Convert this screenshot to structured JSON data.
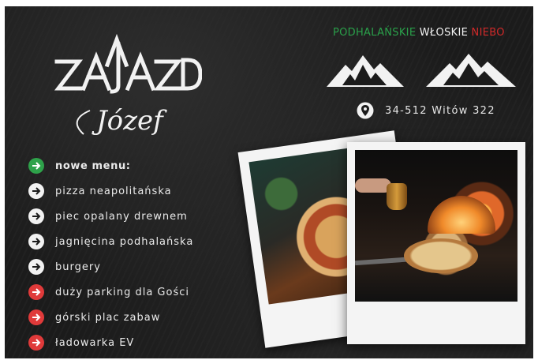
{
  "logo": {
    "word": "ZAJAZD",
    "name": "Józef"
  },
  "tagline": {
    "part1": "PODHALAŃSKIE",
    "part2": "WŁOSKIE",
    "part3": "NIEBO"
  },
  "address": {
    "icon": "location-pin-icon",
    "text": "34-512 Witów 322"
  },
  "menu": {
    "heading": "nowe menu:",
    "items": [
      "pizza neapolitańska",
      "piec opalany drewnem",
      "jagnięcina podhalańska",
      "burgery",
      "duży parking dla Gości",
      "górski plac zabaw",
      "ładowarka EV"
    ]
  },
  "colors": {
    "green": "#2ea24a",
    "white": "#f2f2f2",
    "red": "#e03a3a",
    "background": "#1b1b1b"
  }
}
